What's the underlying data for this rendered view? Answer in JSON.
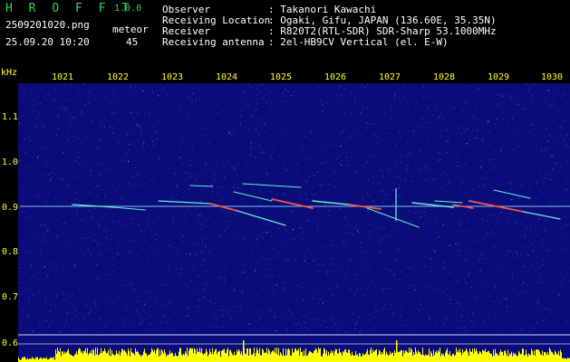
{
  "app": {
    "name": "H R O F F T",
    "version": "1.0.0",
    "file": "2509201020.png",
    "timestamp": "25.09.20 10:20"
  },
  "meteor": {
    "label": "meteor",
    "count": "45"
  },
  "info": [
    {
      "key": "Observer",
      "value": ": Takanori Kawachi"
    },
    {
      "key": "Receiving Location",
      "value": ": Ogaki, Gifu, JAPAN (136.60E, 35.35N)"
    },
    {
      "key": "Receiver",
      "value": ": R820T2(RTL-SDR) SDR-Sharp 53.1000MHz"
    },
    {
      "key": "Receiving antenna",
      "value": ": 2el-HB9CV Vertical (el. E-W)"
    }
  ],
  "axes": {
    "y_unit": "kHz",
    "x_ticks": [
      "1021",
      "1022",
      "1023",
      "1024",
      "1025",
      "1026",
      "1027",
      "1028",
      "1029",
      "1030"
    ],
    "y_ticks": [
      "1.1",
      "1.0",
      "0.9",
      "0.8",
      "0.7",
      "0.6"
    ]
  },
  "spectrogram": {
    "carrier_khz": 0.9,
    "colors": {
      "background": "#0a0c7a",
      "noise_light": "#3c6cff",
      "carrier": "#9ad9ff",
      "echo": "#66ffd6",
      "echo_hot": "#ff5a4a",
      "level_bars": "#ffff00",
      "text_header": "#ffffff",
      "text_axis": "#ffff33",
      "app_name": "#2fd35a"
    }
  }
}
